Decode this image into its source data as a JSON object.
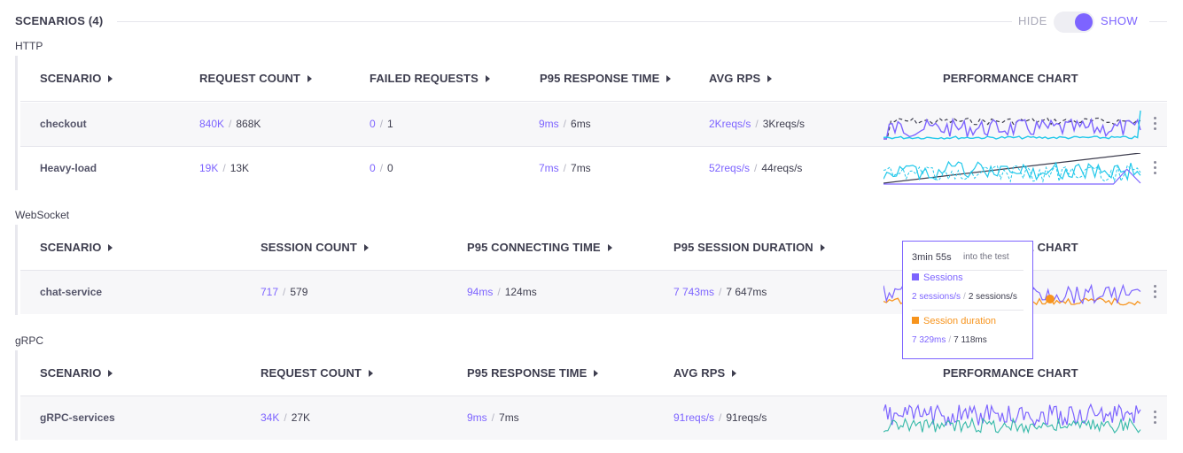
{
  "header": {
    "title": "SCENARIOS (4)",
    "hide_label": "HIDE",
    "show_label": "SHOW",
    "toggle_state": "show"
  },
  "colors": {
    "accent": "#7d64ff",
    "cyan": "#22c8ea",
    "orange": "#f7941d",
    "dark": "#3d3d4e",
    "teal": "#35b9a8"
  },
  "http": {
    "label": "HTTP",
    "columns": [
      "SCENARIO",
      "REQUEST COUNT",
      "FAILED REQUESTS",
      "P95 RESPONSE TIME",
      "AVG RPS",
      "PERFORMANCE CHART"
    ],
    "rows": [
      {
        "name": "checkout",
        "request_count": {
          "a": "840K",
          "b": "868K"
        },
        "failed": {
          "a": "0",
          "b": "1"
        },
        "p95": {
          "a": "9ms",
          "b": "6ms"
        },
        "rps": {
          "a": "2Kreqs/s",
          "b": "3Kreqs/s"
        }
      },
      {
        "name": "Heavy-load",
        "request_count": {
          "a": "19K",
          "b": "13K"
        },
        "failed": {
          "a": "0",
          "b": "0"
        },
        "p95": {
          "a": "7ms",
          "b": "7ms"
        },
        "rps": {
          "a": "52reqs/s",
          "b": "44reqs/s"
        }
      }
    ]
  },
  "websocket": {
    "label": "WebSocket",
    "columns": [
      "SCENARIO",
      "SESSION COUNT",
      "P95 CONNECTING TIME",
      "P95 SESSION DURATION",
      "PERFORMANCE CHART"
    ],
    "rows": [
      {
        "name": "chat-service",
        "session_count": {
          "a": "717",
          "b": "579"
        },
        "p95_connecting": {
          "a": "94ms",
          "b": "124ms"
        },
        "p95_duration": {
          "a": "7 743ms",
          "b": "7 647ms"
        }
      }
    ]
  },
  "grpc": {
    "label": "gRPC",
    "columns": [
      "SCENARIO",
      "REQUEST COUNT",
      "P95 RESPONSE TIME",
      "AVG RPS",
      "PERFORMANCE CHART"
    ],
    "rows": [
      {
        "name": "gRPC-services",
        "request_count": {
          "a": "34K",
          "b": "27K"
        },
        "p95": {
          "a": "9ms",
          "b": "7ms"
        },
        "rps": {
          "a": "91reqs/s",
          "b": "91reqs/s"
        }
      }
    ]
  },
  "tooltip": {
    "time": "3min 55s",
    "into": "into the test",
    "sessions_label": "Sessions",
    "sessions_a": "2 sessions/s",
    "sessions_b": "2 sessions/s",
    "duration_label": "Session duration",
    "duration_a": "7 329ms",
    "duration_b": "7 118ms"
  }
}
